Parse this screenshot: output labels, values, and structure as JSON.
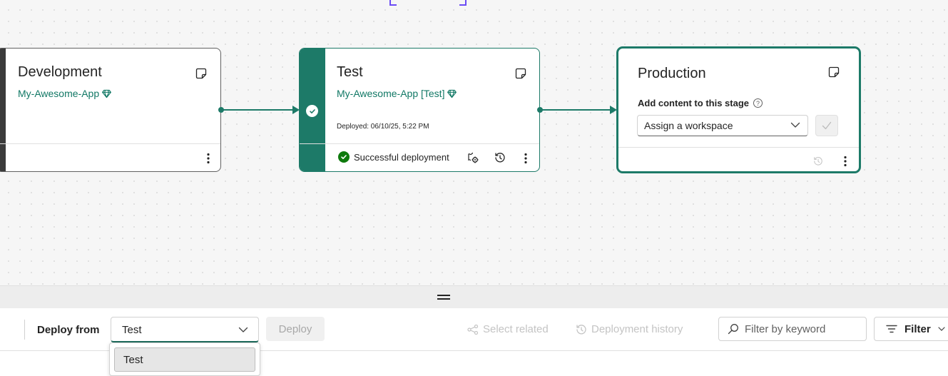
{
  "colors": {
    "accent": "#1d7a68",
    "dev_accent": "#3b3b3b",
    "link": "#117865",
    "success": "#0e7a0d",
    "canvas_bg": "#f6f6f6"
  },
  "stages": {
    "development": {
      "title": "Development",
      "workspace": "My-Awesome-App",
      "icons": [
        "premium-diamond-icon",
        "note-icon",
        "more-options-icon"
      ]
    },
    "test": {
      "title": "Test",
      "workspace": "My-Awesome-App [Test]",
      "deployed": "Deployed: 06/10/25, 5:22 PM",
      "status": "Successful deployment",
      "icons": [
        "premium-diamond-icon",
        "note-icon",
        "checkmark-icon",
        "success-icon",
        "deployment-rules-icon",
        "history-icon",
        "more-options-icon"
      ]
    },
    "production": {
      "title": "Production",
      "add_content_label": "Add content to this stage",
      "workspace_placeholder": "Assign a workspace",
      "icons": [
        "note-icon",
        "help-icon",
        "chevron-down-icon",
        "checkmark-icon",
        "history-icon",
        "more-options-icon"
      ]
    }
  },
  "toolbar": {
    "deploy_from_label": "Deploy from",
    "deploy_from_value": "Test",
    "deploy_label": "Deploy",
    "select_related_label": "Select related",
    "deployment_history_label": "Deployment history",
    "search_placeholder": "Filter by keyword",
    "filter_label": "Filter"
  },
  "dropdown": {
    "options": [
      "Test"
    ]
  }
}
